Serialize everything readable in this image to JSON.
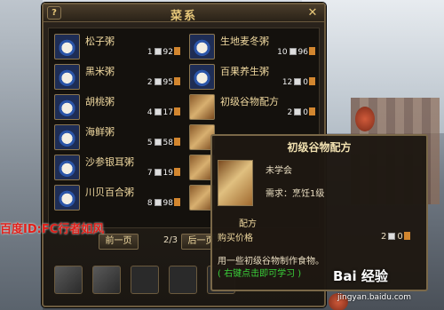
{
  "panel": {
    "title": "菜系",
    "help_label": "?",
    "close_label": "✕"
  },
  "recipes_left": [
    {
      "name": "松子粥",
      "count": "1",
      "points": "92"
    },
    {
      "name": "黑米粥",
      "count": "2",
      "points": "95"
    },
    {
      "name": "胡桃粥",
      "count": "4",
      "points": "17"
    },
    {
      "name": "海鲜粥",
      "count": "5",
      "points": "58"
    },
    {
      "name": "沙参银耳粥",
      "count": "7",
      "points": "19"
    },
    {
      "name": "川贝百合粥",
      "count": "8",
      "points": "98"
    }
  ],
  "recipes_right": [
    {
      "name": "生地麦冬粥",
      "count": "10",
      "points": "96"
    },
    {
      "name": "百果养生粥",
      "count": "12",
      "points": "0"
    },
    {
      "name": "初级谷物配方",
      "count": "2",
      "points": "0"
    }
  ],
  "nav": {
    "prev_label": "前一页",
    "page": "2/3",
    "next_label": "后一页"
  },
  "watermark": "百度ID:FC行者如风",
  "tooltip": {
    "title": "初级谷物配方",
    "status": "未学会",
    "requirement": "需求：烹饪1级",
    "section": "配方",
    "price_label": "购买价格",
    "price_count": "2",
    "price_points": "0",
    "description": "用一些初级谷物制作食物。",
    "hint": "( 右键点击即可学习 )"
  },
  "baidu_logo": "Bai 经验",
  "baidu_url": "jingyan.baidu.com"
}
